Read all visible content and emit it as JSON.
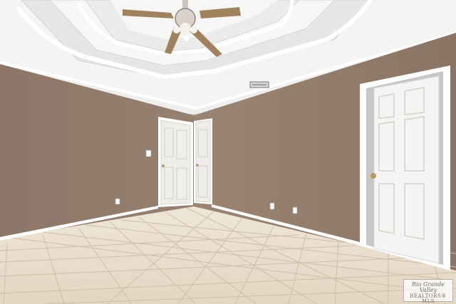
{
  "watermark": {
    "line1": "Rio Grande Valley",
    "line2": "REALTORS® MLS"
  },
  "colors": {
    "wall": "#8d7868",
    "ceiling": "#f2f2f0",
    "trim": "#ffffff",
    "floor_tile": "#e8dccb",
    "grout": "#c9bba6"
  },
  "icons": [
    "ceiling-fan-icon",
    "door-knob-icon",
    "air-vent-icon",
    "outlet-icon",
    "light-switch-icon"
  ]
}
